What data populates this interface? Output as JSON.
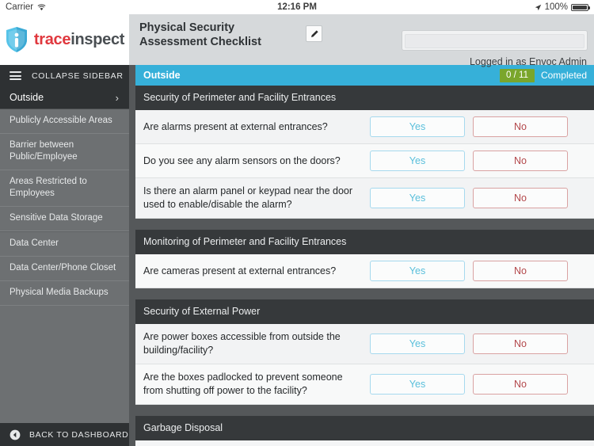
{
  "statusbar": {
    "carrier": "Carrier",
    "wifi_icon": "wifi-icon",
    "time": "12:16 PM",
    "location_icon": "location-arrow-icon",
    "battery_percent": "100%",
    "battery_icon": "battery-full-icon"
  },
  "brand": {
    "logo_icon": "shield-info-logo",
    "name_part1": "trace",
    "name_part2": "inspect"
  },
  "header": {
    "document_title": "Physical Security Assessment Checklist",
    "edit_icon": "pencil-edit-icon",
    "search_value": "",
    "search_placeholder": "",
    "logged_in_text": "Logged in as Envoc Admin"
  },
  "sidebar": {
    "collapse_label": "COLLAPSE SIDEBAR",
    "menu_icon": "hamburger-menu-icon",
    "active_item": "Outside",
    "chevron_icon": "chevron-right-icon",
    "items": [
      "Publicly Accessible Areas",
      "Barrier between Public/Employee",
      "Areas Restricted to Employees",
      "Sensitive Data Storage",
      "Data Center",
      "Data Center/Phone Closet",
      "Physical Media Backups"
    ],
    "back_label": "BACK TO DASHBOARD",
    "back_icon": "back-circle-arrow-icon"
  },
  "group": {
    "title": "Outside",
    "count": "0 / 11",
    "completed_label": "Completed",
    "accent_color": "#36b0d9",
    "badge_color": "#7aa62c"
  },
  "answers": {
    "yes": "Yes",
    "no": "No"
  },
  "sections": [
    {
      "title": "Security of Perimeter and Facility Entrances",
      "questions": [
        "Are alarms present at external entrances?",
        "Do you see any alarm sensors on the doors?",
        "Is there an alarm panel or keypad near the door used to enable/disable the alarm?"
      ]
    },
    {
      "title": "Monitoring of Perimeter and Facility Entrances",
      "questions": [
        "Are cameras present at external entrances?"
      ]
    },
    {
      "title": "Security of External Power",
      "questions": [
        "Are power boxes accessible from outside the building/facility?",
        "Are the boxes padlocked to prevent someone from shutting off power to the facility?"
      ]
    },
    {
      "title": "Garbage Disposal",
      "questions": []
    }
  ]
}
